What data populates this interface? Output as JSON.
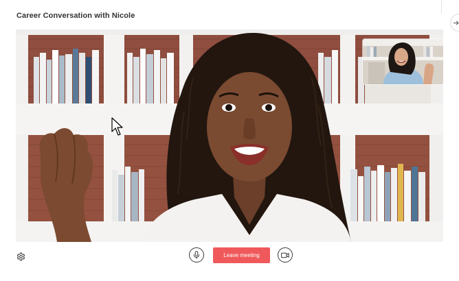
{
  "meeting": {
    "title": "Career Conversation with Nicole"
  },
  "main_video": {
    "participant_role": "remote speaker",
    "icon": "video-feed"
  },
  "self_view": {
    "icon": "self-view-thumbnail"
  },
  "controls": {
    "settings_icon": "gear-icon",
    "mic_icon": "microphone-icon",
    "leave_label": "Leave meeting",
    "camera_icon": "video-camera-icon"
  },
  "colors": {
    "leave_button": "#f0595b",
    "title_text": "#333333",
    "control_outline": "#3a3a3a"
  },
  "sidebar_toggle": {
    "icon": "arrow-right-icon"
  }
}
